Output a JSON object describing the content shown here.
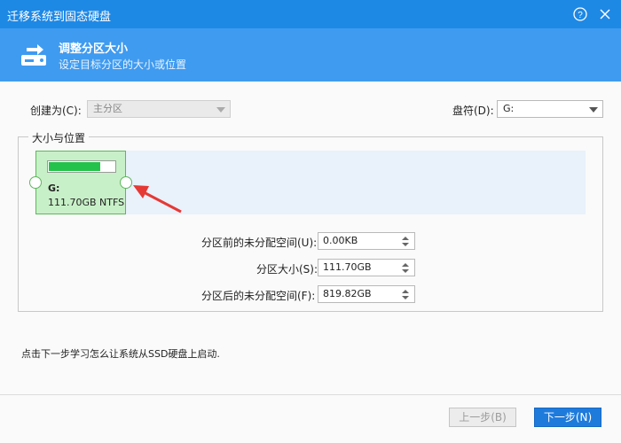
{
  "window": {
    "title": "迁移系统到固态硬盘",
    "help_glyph": "?",
    "close_glyph": "✕"
  },
  "header": {
    "title": "调整分区大小",
    "subtitle": "设定目标分区的大小或位置",
    "icon": "disk-arrow-icon"
  },
  "form": {
    "create_as_label": "创建为(C):",
    "create_as_value": "主分区",
    "drive_letter_label": "盘符(D):",
    "drive_letter_value": "G:"
  },
  "size_position": {
    "legend": "大小与位置",
    "partition": {
      "name": "G:",
      "info": "111.70GB NTFS",
      "used_fraction": 0.78
    }
  },
  "fields": {
    "unalloc_before_label": "分区前的未分配空间(U):",
    "unalloc_before_value": "0.00KB",
    "size_label": "分区大小(S):",
    "size_value": "111.70GB",
    "unalloc_after_label": "分区后的未分配空间(F):",
    "unalloc_after_value": "819.82GB"
  },
  "info_text": "点击下一步学习怎么让系统从SSD硬盘上启动.",
  "buttons": {
    "prev": "上一步(B)",
    "next": "下一步(N)"
  },
  "colors": {
    "titlebar": "#1e88e5",
    "header": "#3f9bf0",
    "partition_fill": "#c8f0c8",
    "used_bar": "#24c24a",
    "arrow": "#e53935",
    "next_button": "#1e7bdc"
  }
}
